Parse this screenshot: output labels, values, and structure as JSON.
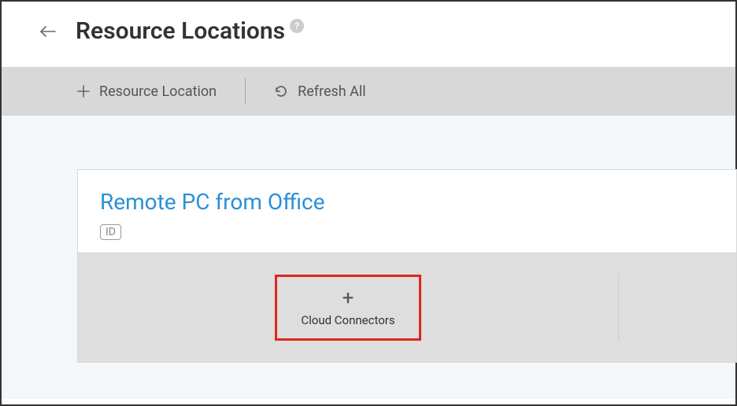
{
  "header": {
    "title": "Resource Locations",
    "help_symbol": "?"
  },
  "toolbar": {
    "add_label": "Resource Location",
    "refresh_label": "Refresh All"
  },
  "card": {
    "title": "Remote PC from Office",
    "id_badge": "ID",
    "add_connector_label": "Cloud Connectors"
  }
}
